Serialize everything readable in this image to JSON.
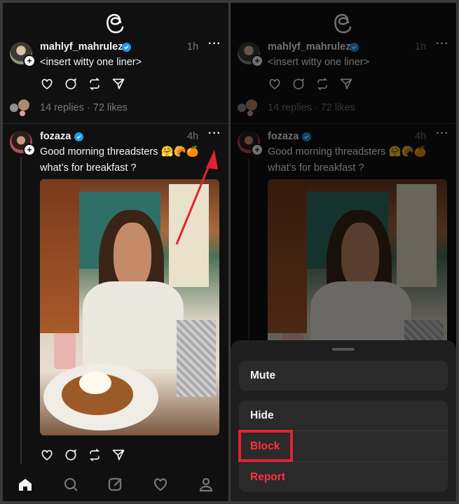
{
  "feed": {
    "posts": [
      {
        "username": "mahlyf_mahrulez",
        "time": "1h",
        "text": "<insert witty one liner>",
        "meta": "14 replies · 72 likes"
      },
      {
        "username": "fozaza",
        "time": "4h",
        "text_line1": "Good morning threadsters 🤗🥐🍊",
        "text_line2": "what’s for breakfast ?"
      }
    ]
  },
  "menu": {
    "group1": [
      "Mute"
    ],
    "group2": [
      "Hide",
      "Block",
      "Report"
    ]
  },
  "nav": [
    "home-icon",
    "search-icon",
    "compose-icon",
    "heart-icon",
    "profile-icon"
  ],
  "colors": {
    "danger": "#ff3040",
    "verified": "#1d9bf0",
    "annotation": "#e1232d"
  }
}
